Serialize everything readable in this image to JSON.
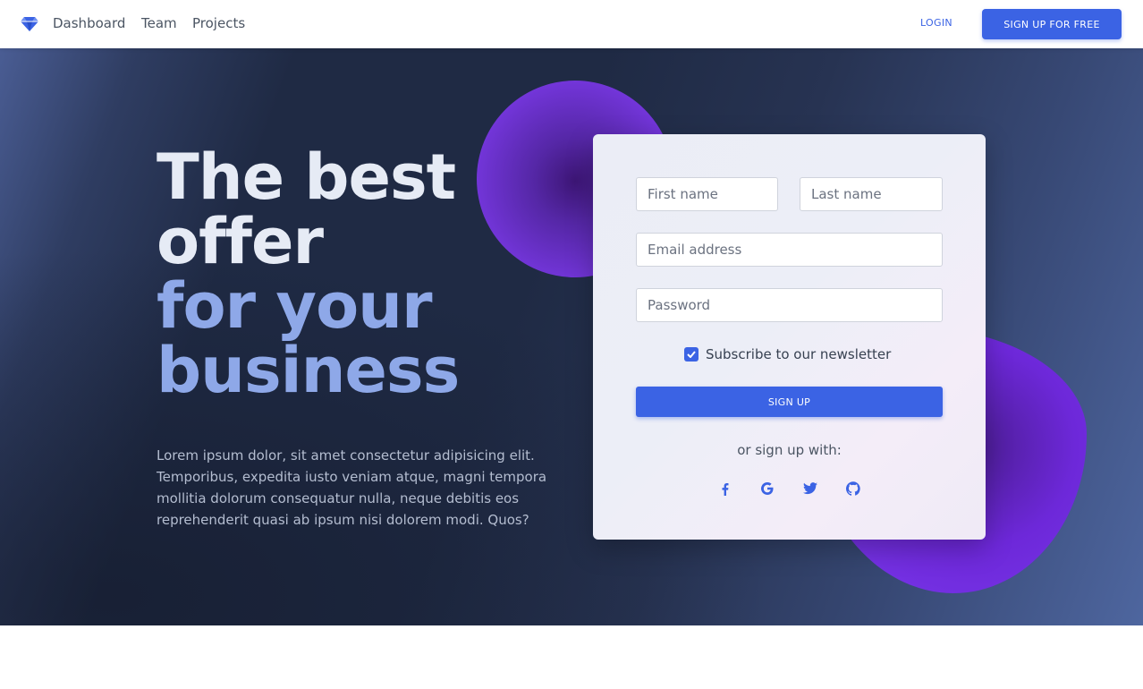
{
  "navbar": {
    "links": [
      "Dashboard",
      "Team",
      "Projects"
    ],
    "login_label": "LOGIN",
    "signup_free_label": "SIGN UP FOR FREE",
    "brand_icon": "diamond-icon"
  },
  "hero": {
    "headline_line1": "The best",
    "headline_line2": "offer",
    "headline_line3": "for your",
    "headline_line4": "business",
    "lead": "Lorem ipsum dolor, sit amet consectetur adipisicing elit. Temporibus, expedita iusto veniam atque, magni tempora mollitia dolorum consequatur nulla, neque debitis eos reprehenderit quasi ab ipsum nisi dolorem modi. Quos?"
  },
  "form": {
    "first_name_placeholder": "First name",
    "last_name_placeholder": "Last name",
    "email_placeholder": "Email address",
    "password_placeholder": "Password",
    "newsletter_label": "Subscribe to our newsletter",
    "newsletter_checked": true,
    "signup_label": "SIGN UP",
    "or_text": "or sign up with:",
    "social_icons": [
      "facebook-icon",
      "google-icon",
      "twitter-icon",
      "github-icon"
    ]
  },
  "colors": {
    "accent": "#3b63e4",
    "headline_light": "#e6ebf5",
    "headline_blue": "#8ea8e8",
    "blob": "#7c3aed"
  }
}
